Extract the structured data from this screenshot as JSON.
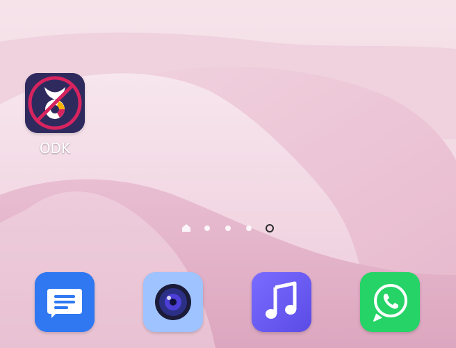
{
  "home_screen": {
    "apps": [
      {
        "label": "ODK",
        "icon": "odk-icon"
      }
    ],
    "page_indicator": {
      "pages": 5,
      "current_page": 5,
      "first_page_icon": "home-icon"
    },
    "dock": [
      {
        "icon": "messages-icon"
      },
      {
        "icon": "camera-icon"
      },
      {
        "icon": "music-icon"
      },
      {
        "icon": "whatsapp-icon"
      }
    ]
  },
  "colors": {
    "odk_background": "#2f2a5e",
    "odk_ring": "#d7245f",
    "messages_blue": "#2f78f2",
    "camera_blue": "#9ec3ff",
    "music_purple": "#6b5cf5",
    "whatsapp_green": "#25d366"
  }
}
